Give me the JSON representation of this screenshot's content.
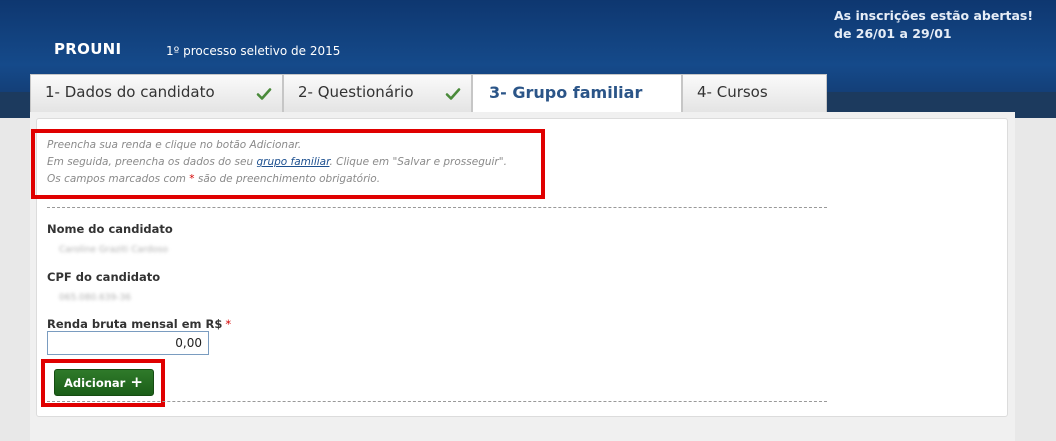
{
  "header": {
    "logo": "PROUNI",
    "subtitle": "1º processo seletivo de 2015",
    "notice_line1": "As inscrições estão abertas!",
    "notice_line2": "de 26/01 a 29/01"
  },
  "tabs": [
    {
      "label": "1- Dados do candidato",
      "completed": true,
      "check_icon": "checkmark-icon"
    },
    {
      "label": "2- Questionário",
      "completed": true,
      "check_icon": "checkmark-icon"
    },
    {
      "label": "3- Grupo familiar",
      "active": true
    },
    {
      "label": "4- Cursos"
    }
  ],
  "instructions": {
    "line1": "Preencha sua renda e clique no botão Adicionar.",
    "line2_prefix": "Em seguida, preencha os dados do seu ",
    "line2_link": "grupo familiar",
    "line2_suffix": ". Clique em \"Salvar e prosseguir\".",
    "line3_prefix": "Os campos marcados com ",
    "line3_star": "*",
    "line3_suffix": " são de preenchimento obrigatório."
  },
  "form": {
    "name_label": "Nome do candidato",
    "name_value": "Caroline Graziti Cardoso",
    "cpf_label": "CPF do candidato",
    "cpf_value": "065.080.639-36",
    "income_label": "Renda bruta mensal em R$",
    "required_star": "*",
    "income_value": "0,00"
  },
  "buttons": {
    "add_label": "Adicionar",
    "add_icon": "+"
  },
  "colors": {
    "header_blue": "#154a8a",
    "active_tab_text": "#2b5588",
    "button_green": "#1f6a1c",
    "highlight_red": "#e00000"
  }
}
